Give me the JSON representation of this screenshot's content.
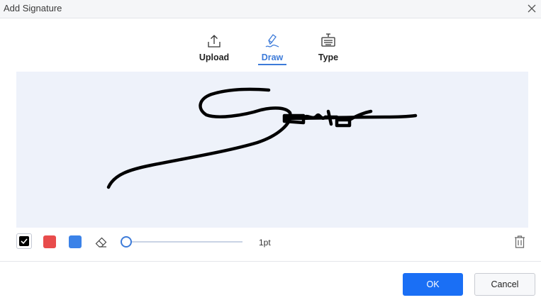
{
  "window": {
    "title": "Add Signature",
    "close_icon": "close-icon"
  },
  "tabs": [
    {
      "label": "Upload",
      "icon": "upload-icon",
      "active": false
    },
    {
      "label": "Draw",
      "icon": "pen-draw-icon",
      "active": true
    },
    {
      "label": "Type",
      "icon": "keyboard-text-icon",
      "active": false
    }
  ],
  "canvas": {
    "background": "#eef2fa",
    "stroke_color": "#000000",
    "content": "handwritten signature"
  },
  "toolbar": {
    "colors": [
      {
        "name": "black",
        "hex": "#000000",
        "selected": true
      },
      {
        "name": "red",
        "hex": "#e84c4c",
        "selected": false
      },
      {
        "name": "blue",
        "hex": "#3b82e8",
        "selected": false
      }
    ],
    "eraser_icon": "eraser-icon",
    "stroke_size_fraction": 0,
    "stroke_size_label": "1pt",
    "trash_icon": "trash-icon"
  },
  "footer": {
    "ok_label": "OK",
    "cancel_label": "Cancel"
  },
  "colors": {
    "accent": "#3d7bd9",
    "primary_button": "#1a6ff5"
  }
}
